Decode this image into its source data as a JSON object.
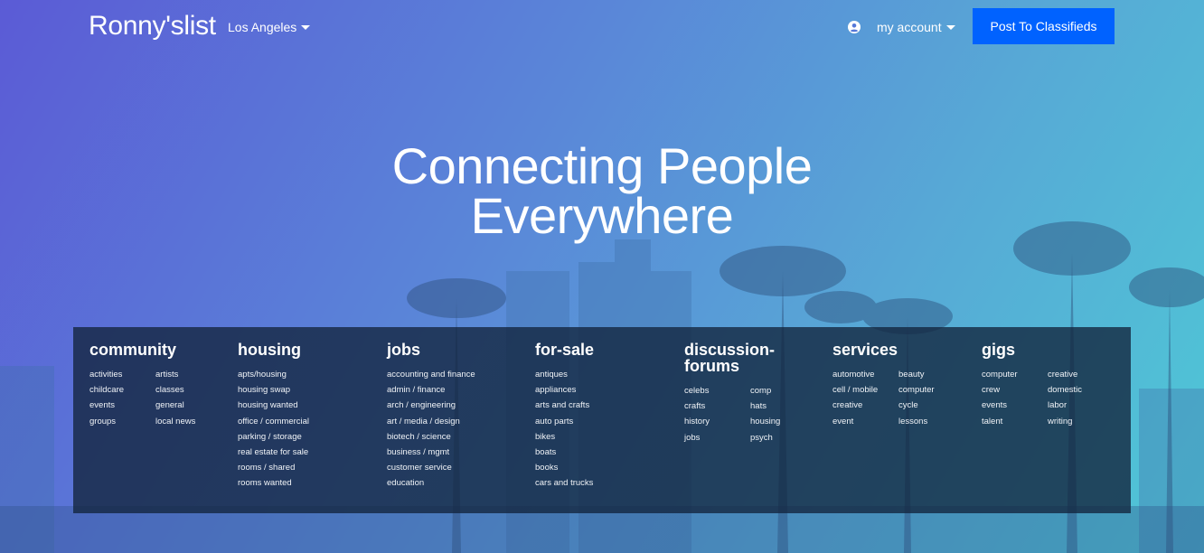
{
  "nav": {
    "brand": "Ronny'slist",
    "city": "Los Angeles",
    "account": "my account",
    "post_button": "Post To Classifieds"
  },
  "hero": {
    "line1": "Connecting People",
    "line2": "Everywhere"
  },
  "categories": {
    "community": {
      "title": "community",
      "col1": [
        "activities",
        "childcare",
        "events",
        "groups"
      ],
      "col2": [
        "artists",
        "classes",
        "general",
        "local news"
      ]
    },
    "housing": {
      "title": "housing",
      "items": [
        "apts/housing",
        "housing swap",
        "housing wanted",
        "office / commercial",
        "parking / storage",
        "real estate for sale",
        "rooms / shared",
        "rooms wanted"
      ]
    },
    "jobs": {
      "title": "jobs",
      "items": [
        "accounting and finance",
        "admin / finance",
        "arch / engineering",
        "art / media / design",
        "biotech / science",
        "business / mgmt",
        "customer service",
        "education"
      ]
    },
    "for_sale": {
      "title": "for-sale",
      "items": [
        "antiques",
        "appliances",
        "arts and crafts",
        "auto parts",
        "bikes",
        "boats",
        "books",
        "cars and trucks"
      ]
    },
    "forums": {
      "title_line1": "discussion-",
      "title_line2": "forums",
      "col1": [
        "celebs",
        "crafts",
        "history",
        "jobs"
      ],
      "col2": [
        "comp",
        "hats",
        "housing",
        "psych"
      ]
    },
    "services": {
      "title": "services",
      "col1": [
        "automotive",
        "cell / mobile",
        "creative",
        "event"
      ],
      "col2": [
        "beauty",
        "computer",
        "cycle",
        "lessons"
      ]
    },
    "gigs": {
      "title": "gigs",
      "col1": [
        "computer",
        "crew",
        "events",
        "talent"
      ],
      "col2": [
        "creative",
        "domestic",
        "labor",
        "writing"
      ]
    }
  },
  "icons": {
    "account": "user-circle-icon",
    "dropdown": "caret-down-icon"
  }
}
